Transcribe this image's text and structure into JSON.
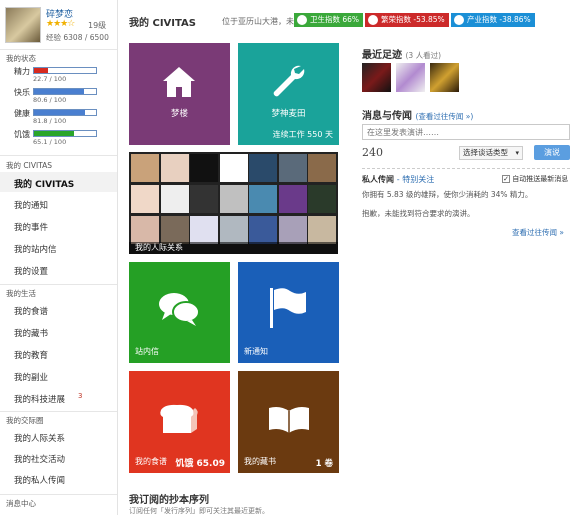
{
  "user": {
    "name": "碎梦恋",
    "level": "19级",
    "stars": "★★★☆",
    "exp": "经验 6308 / 6500"
  },
  "status": {
    "title": "我的状态",
    "stats": [
      {
        "label": "精力",
        "value": "22.7 / 100",
        "fraction": 0.227,
        "color": "#d62a1f"
      },
      {
        "label": "快乐",
        "value": "80.6 / 100",
        "fraction": 0.806,
        "color": "#4a7fd0"
      },
      {
        "label": "健康",
        "value": "81.8 / 100",
        "fraction": 0.818,
        "color": "#4a7fd0"
      },
      {
        "label": "饥饿",
        "value": "65.1 / 100",
        "fraction": 0.651,
        "color": "#2aa52a"
      }
    ]
  },
  "nav": {
    "civitas_title": "我的 CIVITAS",
    "civitas_items": [
      "我的 CIVITAS",
      "我的通知",
      "我的事件",
      "我的站内信",
      "我的设置"
    ],
    "life_title": "我的生活",
    "life_items": [
      "我的食谱",
      "我的藏书",
      "我的教育",
      "我的副业",
      "我的科技进展"
    ],
    "tech_badge": "3",
    "social_title": "我的交际圈",
    "social_items": [
      "我的人际关系",
      "我的社交活动",
      "我的私人传闻"
    ],
    "msg_title": "消息中心"
  },
  "header": {
    "title": "我的 CIVITAS",
    "location": "位于亚历山大港，未分区",
    "indices": [
      {
        "label": "卫生指数 66%",
        "color": "#3aa83a"
      },
      {
        "label": "繁荣指数 -53.85%",
        "color": "#cc2a2a"
      },
      {
        "label": "产业指数 -38.86%",
        "color": "#1b8fd6"
      }
    ]
  },
  "tiles": {
    "home": {
      "label": "梦楼",
      "color": "#7a3a76",
      "icon": "house-icon"
    },
    "field": {
      "label": "梦神麦田",
      "work": "连续工作 550 天",
      "color": "#1aa39a",
      "icon": "wrench-icon"
    },
    "people": {
      "label": "我的人际关系"
    },
    "inbox": {
      "label": "站内信",
      "color": "#25a025",
      "icon": "chat-icon"
    },
    "notice": {
      "label": "新通知",
      "color": "#1a5fb8",
      "icon": "flag-icon"
    },
    "food": {
      "label": "我的食谱",
      "value": "饥饿 65.09",
      "color": "#e03520",
      "icon": "bread-icon"
    },
    "books": {
      "label": "我的藏书",
      "value": "1 卷",
      "color": "#6b3a10",
      "icon": "book-icon"
    }
  },
  "footprints": {
    "title": "最近足迹",
    "count": "(3 人看过)"
  },
  "messages": {
    "title": "消息与传闻",
    "history_link": "(查看过往传闻 »)",
    "placeholder": "在这里发表演讲……",
    "char_count": "240",
    "select_label": "选择谈话类型",
    "send_label": "演说",
    "private_title": "私人传闻",
    "special_link": "- 特别关注",
    "auto_push": "自动推送最新消息",
    "info_line": "你拥有 5.83 级的雄辩，使你少消耗的 34% 精力。",
    "notice_line": "抱歉，未能找到符合要求的演讲。",
    "more_link": "查看过往传闻 »"
  },
  "subscriptions": {
    "title": "我订阅的抄本序列",
    "hint": "订阅任何「发行序列」即可关注其最近更新。"
  }
}
